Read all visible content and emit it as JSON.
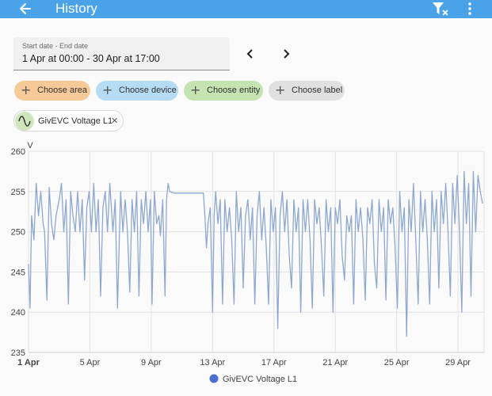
{
  "header": {
    "title": "History"
  },
  "date_range": {
    "label": "Start date - End date",
    "value": "1 Apr at 00:00 - 30 Apr at 17:00"
  },
  "filters": [
    {
      "label": "Choose area",
      "color": "#f6c998"
    },
    {
      "label": "Choose device",
      "color": "#b5dcf4"
    },
    {
      "label": "Choose entity",
      "color": "#c6e3b2"
    },
    {
      "label": "Choose label",
      "color": "#e0e0e0"
    }
  ],
  "entity_chip": {
    "label": "GivEVC Voltage L1",
    "icon": "sine-wave-icon"
  },
  "chart_data": {
    "type": "line",
    "ylabel": "V",
    "ylim": [
      235,
      260
    ],
    "yticks": [
      "260",
      "255",
      "250",
      "245",
      "240",
      "235"
    ],
    "xticks": [
      {
        "label": "1 Apr",
        "day": 0
      },
      {
        "label": "5 Apr",
        "day": 4
      },
      {
        "label": "9 Apr",
        "day": 8
      },
      {
        "label": "13 Apr",
        "day": 12
      },
      {
        "label": "17 Apr",
        "day": 16
      },
      {
        "label": "21 Apr",
        "day": 20
      },
      {
        "label": "25 Apr",
        "day": 24
      },
      {
        "label": "29 Apr",
        "day": 28
      }
    ],
    "xlim_days": [
      0,
      29.7
    ],
    "legend_position": "bottom",
    "color": "#8ea8cf",
    "series": [
      {
        "name": "GivEVC Voltage L1",
        "points": [
          [
            0.0,
            246
          ],
          [
            0.1,
            240.5
          ],
          [
            0.2,
            252
          ],
          [
            0.35,
            249
          ],
          [
            0.5,
            256
          ],
          [
            0.65,
            252
          ],
          [
            0.8,
            255
          ],
          [
            0.95,
            251
          ],
          [
            1.05,
            250
          ],
          [
            1.2,
            241.5
          ],
          [
            1.35,
            255.5
          ],
          [
            1.5,
            251
          ],
          [
            1.65,
            249
          ],
          [
            1.8,
            252
          ],
          [
            2.0,
            254
          ],
          [
            2.15,
            256
          ],
          [
            2.3,
            250
          ],
          [
            2.45,
            254
          ],
          [
            2.6,
            241
          ],
          [
            2.75,
            255
          ],
          [
            2.9,
            252
          ],
          [
            3.05,
            250
          ],
          [
            3.2,
            255
          ],
          [
            3.35,
            250
          ],
          [
            3.5,
            254
          ],
          [
            3.65,
            244
          ],
          [
            3.8,
            253
          ],
          [
            3.95,
            255
          ],
          [
            4.1,
            250
          ],
          [
            4.25,
            256
          ],
          [
            4.4,
            250
          ],
          [
            4.55,
            254
          ],
          [
            4.7,
            242
          ],
          [
            4.85,
            253
          ],
          [
            5.0,
            255
          ],
          [
            5.15,
            250
          ],
          [
            5.3,
            256
          ],
          [
            5.5,
            250
          ],
          [
            5.65,
            254
          ],
          [
            5.8,
            240.5
          ],
          [
            6.0,
            255
          ],
          [
            6.15,
            250
          ],
          [
            6.3,
            254
          ],
          [
            6.45,
            250
          ],
          [
            6.6,
            242.5
          ],
          [
            6.75,
            254
          ],
          [
            6.9,
            250
          ],
          [
            7.05,
            255
          ],
          [
            7.2,
            242
          ],
          [
            7.35,
            254
          ],
          [
            7.5,
            251
          ],
          [
            7.65,
            255
          ],
          [
            7.8,
            250
          ],
          [
            7.95,
            254
          ],
          [
            8.05,
            241
          ],
          [
            8.2,
            255
          ],
          [
            8.35,
            251
          ],
          [
            8.5,
            252
          ],
          [
            8.6,
            249.5
          ],
          [
            8.75,
            254
          ],
          [
            8.9,
            242
          ],
          [
            9.0,
            254
          ],
          [
            9.1,
            256
          ],
          [
            9.2,
            255
          ],
          [
            9.5,
            254.8
          ],
          [
            11.0,
            254.8
          ],
          [
            11.4,
            254.8
          ],
          [
            11.5,
            252
          ],
          [
            11.6,
            248
          ],
          [
            11.7,
            251
          ],
          [
            11.85,
            253
          ],
          [
            12.0,
            240
          ],
          [
            12.1,
            252
          ],
          [
            12.2,
            255
          ],
          [
            12.35,
            251
          ],
          [
            12.5,
            254
          ],
          [
            12.65,
            241
          ],
          [
            12.8,
            254
          ],
          [
            12.95,
            250
          ],
          [
            13.1,
            253
          ],
          [
            13.25,
            249
          ],
          [
            13.4,
            241
          ],
          [
            13.55,
            255
          ],
          [
            13.7,
            250
          ],
          [
            13.85,
            253
          ],
          [
            14.0,
            243
          ],
          [
            14.15,
            252
          ],
          [
            14.3,
            254
          ],
          [
            14.45,
            249
          ],
          [
            14.6,
            253
          ],
          [
            14.75,
            241
          ],
          [
            14.9,
            252
          ],
          [
            15.05,
            255
          ],
          [
            15.2,
            249
          ],
          [
            15.35,
            253
          ],
          [
            15.5,
            248
          ],
          [
            15.65,
            241
          ],
          [
            15.8,
            254
          ],
          [
            15.95,
            250
          ],
          [
            16.1,
            253
          ],
          [
            16.25,
            238
          ],
          [
            16.4,
            252
          ],
          [
            16.55,
            255
          ],
          [
            16.7,
            250
          ],
          [
            16.85,
            254
          ],
          [
            17.0,
            247
          ],
          [
            17.15,
            243
          ],
          [
            17.3,
            254
          ],
          [
            17.45,
            250
          ],
          [
            17.6,
            253
          ],
          [
            17.75,
            240
          ],
          [
            17.9,
            254
          ],
          [
            18.05,
            250
          ],
          [
            18.2,
            254
          ],
          [
            18.35,
            249
          ],
          [
            18.5,
            240.5
          ],
          [
            18.65,
            254
          ],
          [
            18.8,
            251
          ],
          [
            18.95,
            253
          ],
          [
            19.1,
            248
          ],
          [
            19.25,
            242
          ],
          [
            19.4,
            254
          ],
          [
            19.55,
            250
          ],
          [
            19.7,
            253
          ],
          [
            19.85,
            240
          ],
          [
            20.0,
            253
          ],
          [
            20.15,
            251
          ],
          [
            20.3,
            254
          ],
          [
            20.45,
            247
          ],
          [
            20.6,
            244
          ],
          [
            20.75,
            252
          ],
          [
            20.9,
            250
          ],
          [
            21.05,
            252
          ],
          [
            21.2,
            241
          ],
          [
            21.35,
            254
          ],
          [
            21.5,
            250
          ],
          [
            21.65,
            253
          ],
          [
            21.8,
            249
          ],
          [
            21.95,
            241.5
          ],
          [
            22.1,
            253
          ],
          [
            22.25,
            251
          ],
          [
            22.4,
            254
          ],
          [
            22.55,
            246
          ],
          [
            22.7,
            243
          ],
          [
            22.85,
            254
          ],
          [
            23.0,
            250
          ],
          [
            23.15,
            253
          ],
          [
            23.3,
            241.5
          ],
          [
            23.45,
            254
          ],
          [
            23.6,
            251
          ],
          [
            23.75,
            253
          ],
          [
            23.9,
            248
          ],
          [
            24.05,
            240.5
          ],
          [
            24.2,
            255
          ],
          [
            24.35,
            250
          ],
          [
            24.5,
            253
          ],
          [
            24.65,
            237
          ],
          [
            24.8,
            254
          ],
          [
            24.95,
            250
          ],
          [
            25.1,
            256
          ],
          [
            25.25,
            249
          ],
          [
            25.4,
            241
          ],
          [
            25.55,
            255
          ],
          [
            25.7,
            250
          ],
          [
            25.85,
            254
          ],
          [
            26.0,
            249
          ],
          [
            26.15,
            241
          ],
          [
            26.3,
            255
          ],
          [
            26.45,
            250
          ],
          [
            26.6,
            254
          ],
          [
            26.75,
            243
          ],
          [
            26.9,
            255
          ],
          [
            27.05,
            251
          ],
          [
            27.2,
            256
          ],
          [
            27.35,
            250
          ],
          [
            27.5,
            242
          ],
          [
            27.65,
            256
          ],
          [
            27.8,
            251
          ],
          [
            27.95,
            257
          ],
          [
            28.1,
            250
          ],
          [
            28.25,
            240
          ],
          [
            28.4,
            257.5
          ],
          [
            28.55,
            251
          ],
          [
            28.7,
            256
          ],
          [
            28.85,
            242
          ],
          [
            29.0,
            257.5
          ],
          [
            29.15,
            250
          ],
          [
            29.3,
            257
          ],
          [
            29.45,
            255
          ],
          [
            29.6,
            253.5
          ]
        ]
      }
    ]
  }
}
